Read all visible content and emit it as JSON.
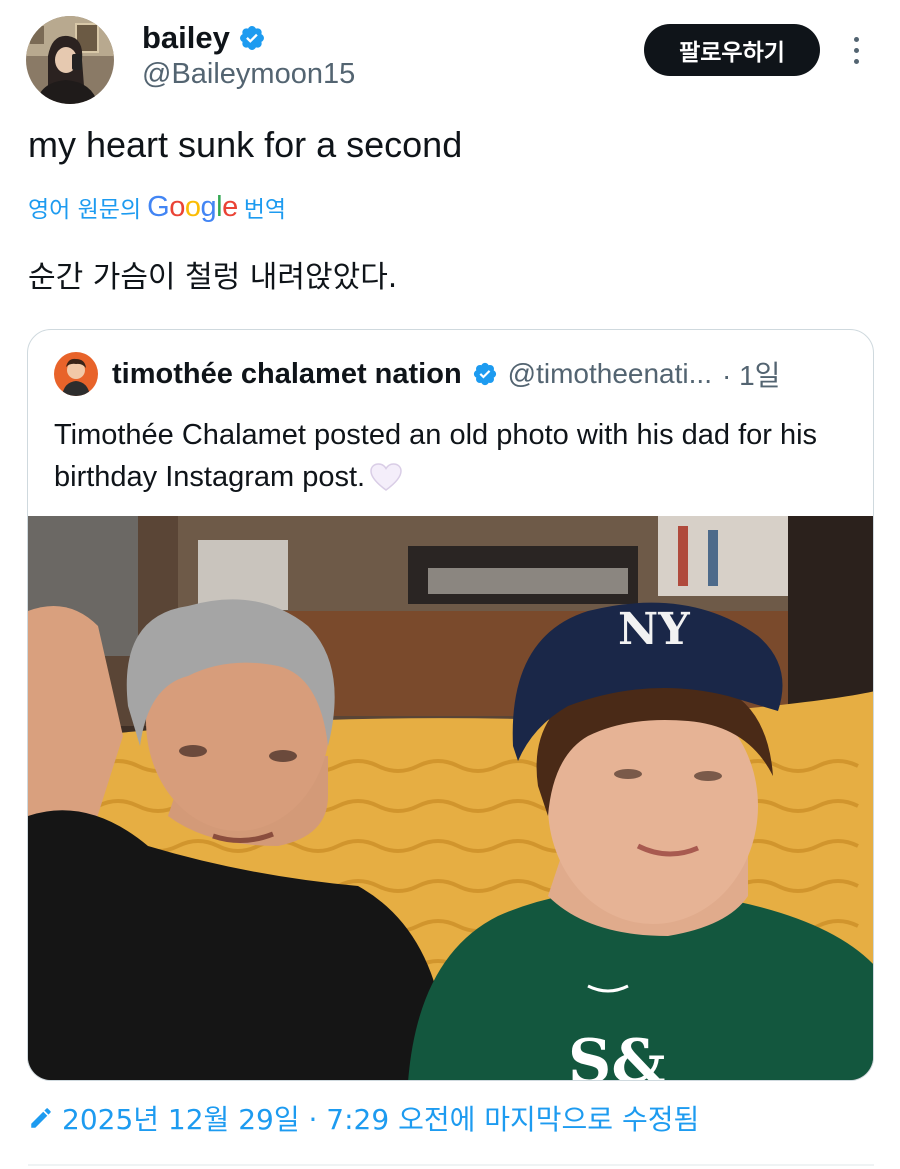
{
  "author": {
    "name": "bailey",
    "handle": "@Baileymoon15",
    "follow_label": "팔로우하기",
    "verified": true
  },
  "tweet": {
    "text": "my heart sunk for a second",
    "translate": {
      "prefix": "영어 원문의",
      "brand": "Google",
      "suffix": "번역"
    },
    "translated_text": "순간 가슴이 철렁 내려앉았다."
  },
  "quoted": {
    "name": "timothée chalamet nation",
    "handle": "@timotheenati...",
    "time": "· 1일",
    "text": "Timothée Chalamet posted an old photo with his dad for his birthday Instagram post.",
    "verified": true
  },
  "edited_note": "2025년 12월 29일 · 7:29 오전에 마지막으로 수정됨",
  "colors": {
    "accent": "#1d9bf0",
    "text_primary": "#0f1419",
    "text_secondary": "#536471",
    "border": "#cfd9de",
    "button_bg": "#0f1419"
  },
  "icons": {
    "verified": "verified-badge-icon",
    "more": "more-vertical-icon",
    "edit": "pencil-icon",
    "heart": "white-heart-icon"
  }
}
